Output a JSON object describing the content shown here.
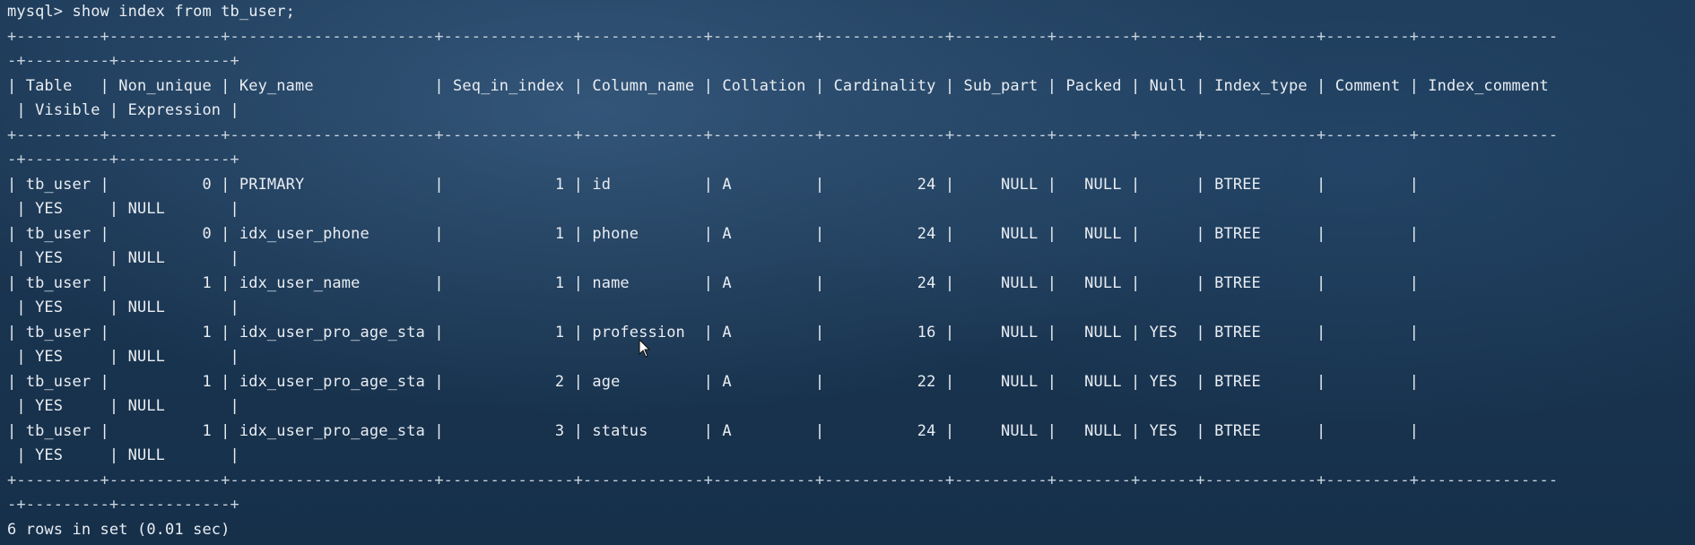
{
  "terminal": {
    "lines": [
      "mysql> show index from tb_user;",
      "+---------+------------+----------------------+--------------+-------------+-----------+-------------+----------+--------+------+------------+---------+---------------",
      "-+---------+------------+",
      "| Table   | Non_unique | Key_name             | Seq_in_index | Column_name | Collation | Cardinality | Sub_part | Packed | Null | Index_type | Comment | Index_comment",
      " | Visible | Expression |",
      "+---------+------------+----------------------+--------------+-------------+-----------+-------------+----------+--------+------+------------+---------+---------------",
      "-+---------+------------+",
      "| tb_user |          0 | PRIMARY              |            1 | id          | A         |          24 |     NULL |   NULL |      | BTREE      |         |",
      " | YES     | NULL       |",
      "| tb_user |          0 | idx_user_phone       |            1 | phone       | A         |          24 |     NULL |   NULL |      | BTREE      |         |",
      " | YES     | NULL       |",
      "| tb_user |          1 | idx_user_name        |            1 | name        | A         |          24 |     NULL |   NULL |      | BTREE      |         |",
      " | YES     | NULL       |",
      "| tb_user |          1 | idx_user_pro_age_sta |            1 | profession  | A         |          16 |     NULL |   NULL | YES  | BTREE      |         |",
      " | YES     | NULL       |",
      "| tb_user |          1 | idx_user_pro_age_sta |            2 | age         | A         |          22 |     NULL |   NULL | YES  | BTREE      |         |",
      " | YES     | NULL       |",
      "| tb_user |          1 | idx_user_pro_age_sta |            3 | status      | A         |          24 |     NULL |   NULL | YES  | BTREE      |         |",
      " | YES     | NULL       |",
      "+---------+------------+----------------------+--------------+-------------+-----------+-------------+----------+--------+------+------------+---------+---------------",
      "-+---------+------------+",
      "6 rows in set (0.01 sec)"
    ]
  },
  "colors": {
    "text": "#e9edf2",
    "border": "#c9d3dd",
    "background": "#1a3551"
  },
  "icons": {
    "mouse_cursor": "arrow-cursor-icon"
  }
}
